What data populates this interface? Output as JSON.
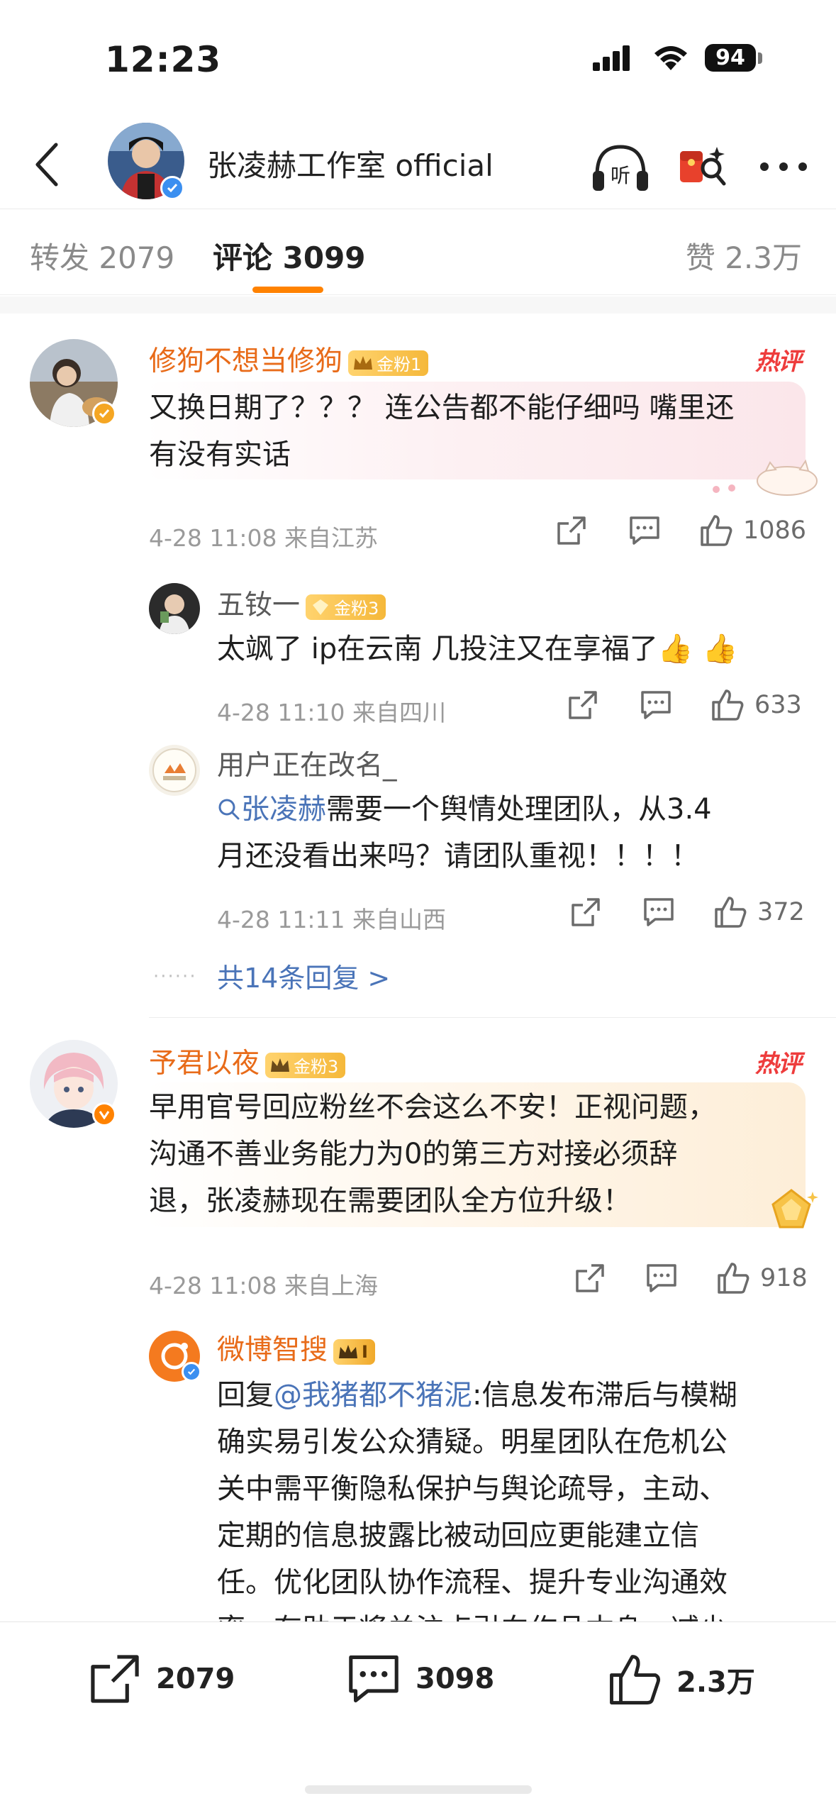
{
  "status": {
    "time": "12:23",
    "battery": "94"
  },
  "header": {
    "title": "张凌赫工作室 official"
  },
  "tabs": [
    {
      "label": "转发 2079"
    },
    {
      "label": "评论 3099"
    },
    {
      "label": "赞 2.3万"
    }
  ],
  "comments": [
    {
      "name": "修狗不想当修狗",
      "badge": "金粉1",
      "hot": "热评",
      "text_line1": "又换日期了？？？ 连公告都不能仔细吗 嘴里还",
      "text_line2": "有没有实话",
      "meta": "4-28 11:08 来自江苏",
      "likes": "1086",
      "replies": [
        {
          "name": "五钕一",
          "badge": "金粉3",
          "text": "太飒了 ip在云南 几投注又在享福了👍 👍",
          "meta": "4-28 11:10 来自四川",
          "likes": "633"
        },
        {
          "name": "用户正在改名_",
          "link": "张凌赫",
          "text_line1": "需要一个舆情处理团队，从3.4",
          "text_line2": "月还没看出来吗？请团队重视！！！！",
          "meta": "4-28 11:11 来自山西",
          "likes": "372"
        }
      ],
      "more": "共14条回复 >"
    },
    {
      "name": "予君以夜",
      "badge": "金粉3",
      "hot": "热评",
      "text_line1": "早用官号回应粉丝不会这么不安！正视问题，",
      "text_line2": "沟通不善业务能力为0的第三方对接必须辞",
      "text_line3": "退，张凌赫现在需要团队全方位升级！",
      "meta": "4-28 11:08 来自上海",
      "likes": "918",
      "reply": {
        "name": "微博智搜",
        "badge": "I",
        "prefix": "回复",
        "mention": "@我猪都不猪泥",
        "line1": ":信息发布滞后与模糊",
        "line2": "确实易引发公众猜疑。明星团队在危机公",
        "line3": "关中需平衡隐私保护与舆论疏导，主动、",
        "line4": "定期的信息披露比被动回应更能建立信",
        "line5": "任。优化团队协作流程、提升专业沟通效",
        "line6": "率，有助于将关注点引向作品本身，减少"
      }
    }
  ],
  "bottom": {
    "reposts": "2079",
    "comments": "3098",
    "likes": "2.3万"
  },
  "colors": {
    "accent": "#ff8200",
    "name": "#e86b19",
    "link": "#4a74b8",
    "hot": "#ee3c3c"
  }
}
